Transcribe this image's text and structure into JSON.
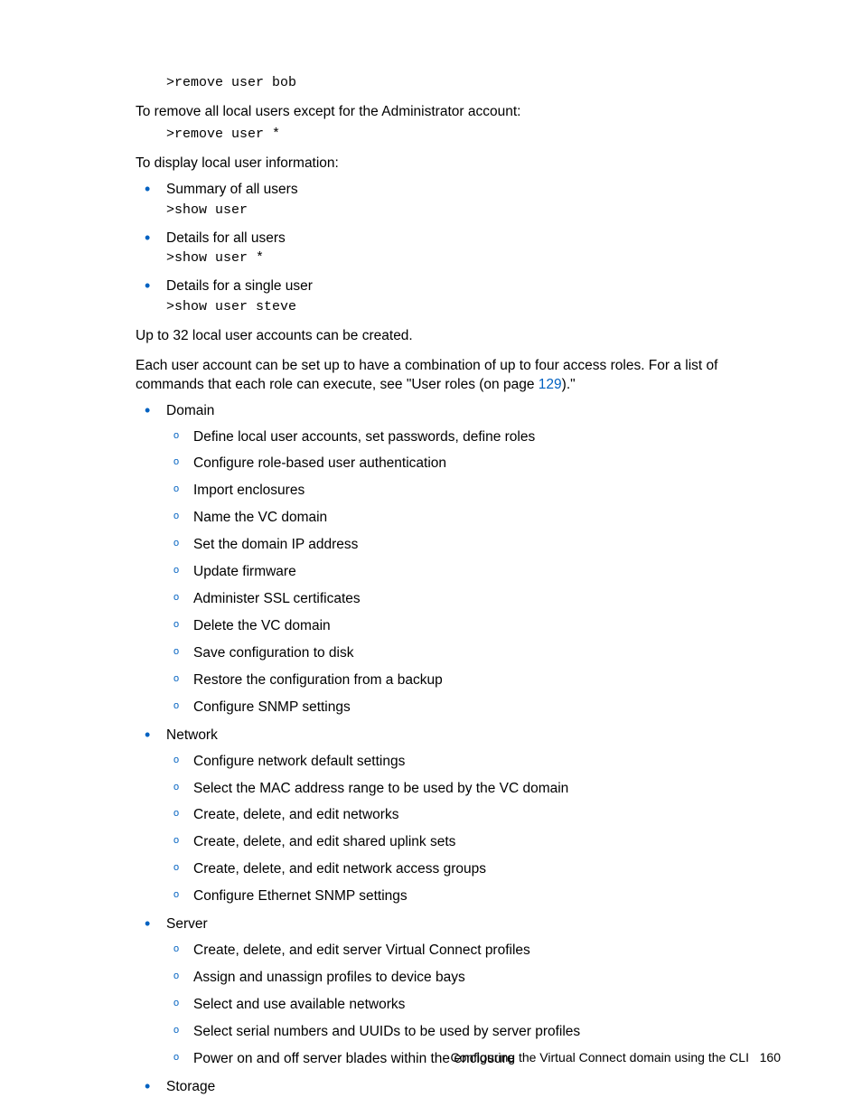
{
  "code1": ">remove user bob",
  "para1": "To remove all local users except for the Administrator account:",
  "code2": ">remove user *",
  "para2": "To display local user information:",
  "bullets1": [
    {
      "text": "Summary of all users",
      "code": ">show user"
    },
    {
      "text": "Details for all users",
      "code": ">show user *"
    },
    {
      "text": "Details for a single user",
      "code": ">show user steve"
    }
  ],
  "para3": "Up to 32 local user accounts can be created.",
  "para4a": "Each user account can be set up to have a combination of up to four access roles. For a list of commands that each role can execute, see \"User roles (on page ",
  "para4link": "129",
  "para4b": ").\"",
  "roles": [
    {
      "name": "Domain",
      "items": [
        "Define local user accounts, set passwords, define roles",
        "Configure role-based user authentication",
        "Import enclosures",
        "Name the VC domain",
        "Set the domain IP address",
        "Update firmware",
        "Administer SSL certificates",
        "Delete the VC domain",
        "Save configuration to disk",
        "Restore the configuration from a backup",
        "Configure SNMP settings"
      ]
    },
    {
      "name": "Network",
      "items": [
        "Configure network default settings",
        "Select the MAC address range to be used by the VC domain",
        "Create, delete, and edit networks",
        "Create, delete, and edit shared uplink sets",
        "Create, delete, and edit network access groups",
        "Configure Ethernet SNMP settings"
      ]
    },
    {
      "name": "Server",
      "items": [
        "Create, delete, and edit server Virtual Connect profiles",
        "Assign and unassign profiles to device bays",
        "Select and use available networks",
        "Select serial numbers and UUIDs to be used by server profiles",
        "Power on and off server blades within the enclosure"
      ]
    },
    {
      "name": "Storage",
      "items": []
    }
  ],
  "footerText": "Configuring the Virtual Connect domain using the CLI",
  "pageNum": "160"
}
